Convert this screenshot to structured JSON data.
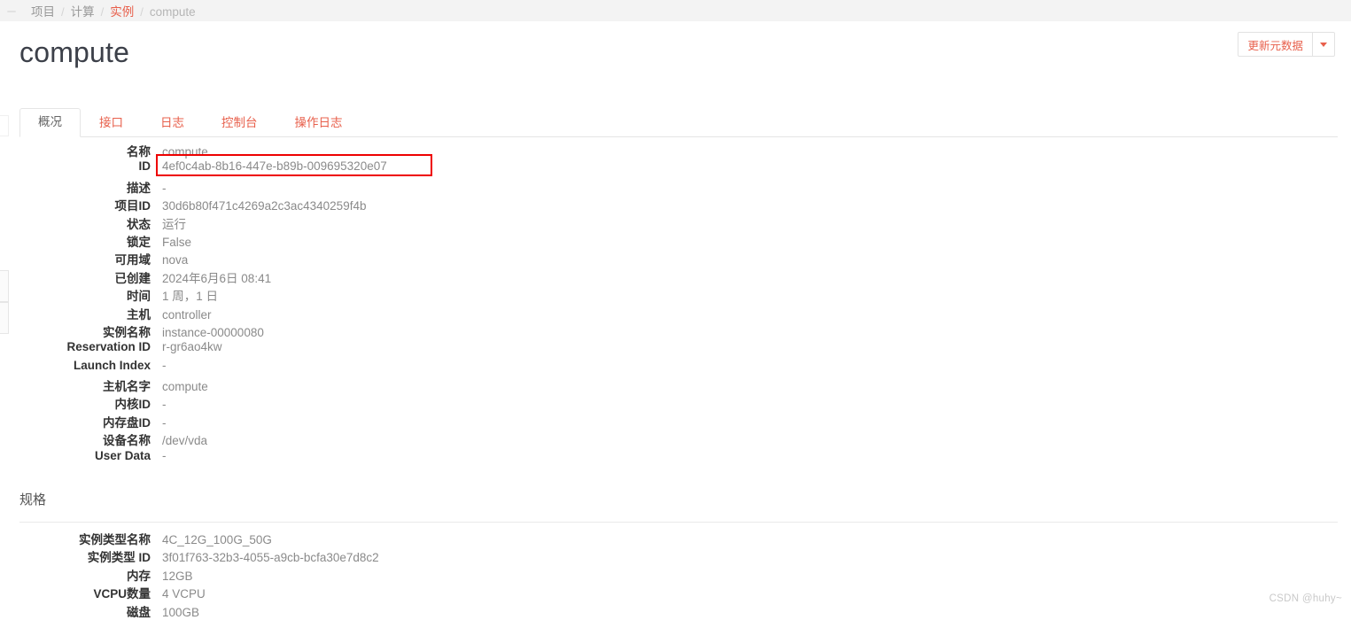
{
  "breadcrumb": {
    "toggle_icon": "menu-collapse-icon",
    "items": [
      {
        "label": "项目",
        "state": "link"
      },
      {
        "label": "计算",
        "state": "link"
      },
      {
        "label": "实例",
        "state": "active"
      },
      {
        "label": "compute",
        "state": "plain"
      }
    ],
    "separator": "/"
  },
  "header": {
    "title": "compute",
    "actions": {
      "primary_label": "更新元数据",
      "caret_icon": "chevron-down-icon"
    }
  },
  "tabs": [
    {
      "label": "概况",
      "active": true
    },
    {
      "label": "接口",
      "active": false
    },
    {
      "label": "日志",
      "active": false
    },
    {
      "label": "控制台",
      "active": false
    },
    {
      "label": "操作日志",
      "active": false
    }
  ],
  "overview": {
    "rows": [
      {
        "label": "名称",
        "value": "compute"
      },
      {
        "label": "ID",
        "value": "4ef0c4ab-8b16-447e-b89b-009695320e07",
        "annotated": true
      },
      {
        "label": "描述",
        "value": "-"
      },
      {
        "label": "项目ID",
        "value": "30d6b80f471c4269a2c3ac4340259f4b"
      },
      {
        "label": "状态",
        "value": "运行"
      },
      {
        "label": "锁定",
        "value": "False"
      },
      {
        "label": "可用域",
        "value": "nova"
      },
      {
        "label": "已创建",
        "value": "2024年6月6日 08:41"
      },
      {
        "label": "时间",
        "value": "1 周，1 日"
      },
      {
        "label": "主机",
        "value": "controller"
      },
      {
        "label": "实例名称",
        "value": "instance-00000080"
      },
      {
        "label": "Reservation ID",
        "value": "r-gr6ao4kw"
      },
      {
        "label": "Launch Index",
        "value": "-"
      },
      {
        "label": "主机名字",
        "value": "compute"
      },
      {
        "label": "内核ID",
        "value": "-"
      },
      {
        "label": "内存盘ID",
        "value": "-"
      },
      {
        "label": "设备名称",
        "value": "/dev/vda"
      },
      {
        "label": "User Data",
        "value": "-"
      }
    ]
  },
  "flavor_section": {
    "heading": "规格",
    "rows": [
      {
        "label": "实例类型名称",
        "value": "4C_12G_100G_50G"
      },
      {
        "label": "实例类型 ID",
        "value": "3f01f763-32b3-4055-a9cb-bcfa30e7d8c2"
      },
      {
        "label": "内存",
        "value": "12GB"
      },
      {
        "label": "VCPU数量",
        "value": "4 VCPU"
      },
      {
        "label": "磁盘",
        "value": "100GB"
      }
    ]
  },
  "watermark": "CSDN @huhy~",
  "colors": {
    "accent": "#e8604c",
    "annotation": "#ee0000",
    "breadcrumb_bg": "#f3f3f3",
    "label_text": "#333333",
    "value_text": "#8a8a8a"
  }
}
